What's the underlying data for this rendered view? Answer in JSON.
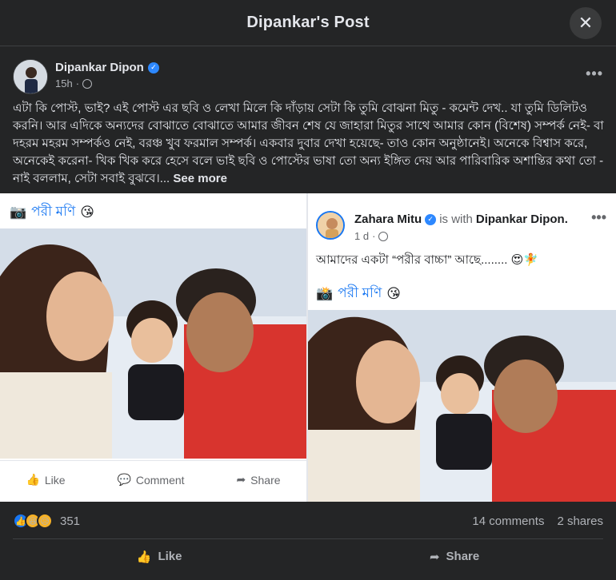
{
  "header": {
    "title": "Dipankar's Post",
    "close_label": "✕"
  },
  "author": {
    "name": "Dipankar Dipon",
    "time": "15h",
    "more": "•••"
  },
  "post": {
    "text": "এটা কি পোস্ট, ভাই?  এই পোস্ট এর ছবি ও লেখা মিলে কি দাঁড়ায় সেটা কি তুমি বোঝনা মিতু - কমেন্ট দেখ.. যা তুমি ডিলিটও করনি। আর এদিকে অন্যদের বোঝাতে বোঝাতে আমার জীবন শেষ যে জাহারা মিতুর সাথে আমার কোন (বিশেষ) সম্পর্ক নেই- বা দহরম মহরম সম্পর্কও নেই, বরঞ্চ খুব ফরমাল সম্পর্ক। একবার দুবার দেখা হয়েছে- তাও কোন অনুষ্ঠানেই। অনেকে বিশ্বাস করে,  অনেকেই করেনা- খিক খিক করে হেসে  বলে ভাই ছবি ও পোস্টের ভাষা তো অন্য ইঙ্গিত দেয় আর পারিবারিক অশান্তির কথা তো - নাই বললাম,  সেটা সবাই বুঝবে।...",
    "see_more": "See more"
  },
  "left_card": {
    "caption_icon": "📷",
    "caption": "পরী মণি",
    "caption_emoji": "😘",
    "like": "Like",
    "comment": "Comment",
    "share": "Share"
  },
  "right_card": {
    "name": "Zahara Mitu",
    "with_text": "is with",
    "with_name": "Dipankar Dipon.",
    "time": "1 d",
    "more": "•••",
    "text": "আমাদের একটা “পরীর বাচ্চা” আছে........",
    "text_emojis": "😍🧚",
    "caption_icon": "📸",
    "caption": "পরী মণি",
    "caption_emoji": "😘"
  },
  "stats": {
    "reaction_count": "351",
    "comments": "14 comments",
    "shares": "2 shares"
  },
  "actions": {
    "like": "Like",
    "share": "Share"
  },
  "colors": {
    "background": "#242526",
    "accent": "#1877f2",
    "text": "#e4e6eb",
    "muted": "#b0b3b8"
  }
}
